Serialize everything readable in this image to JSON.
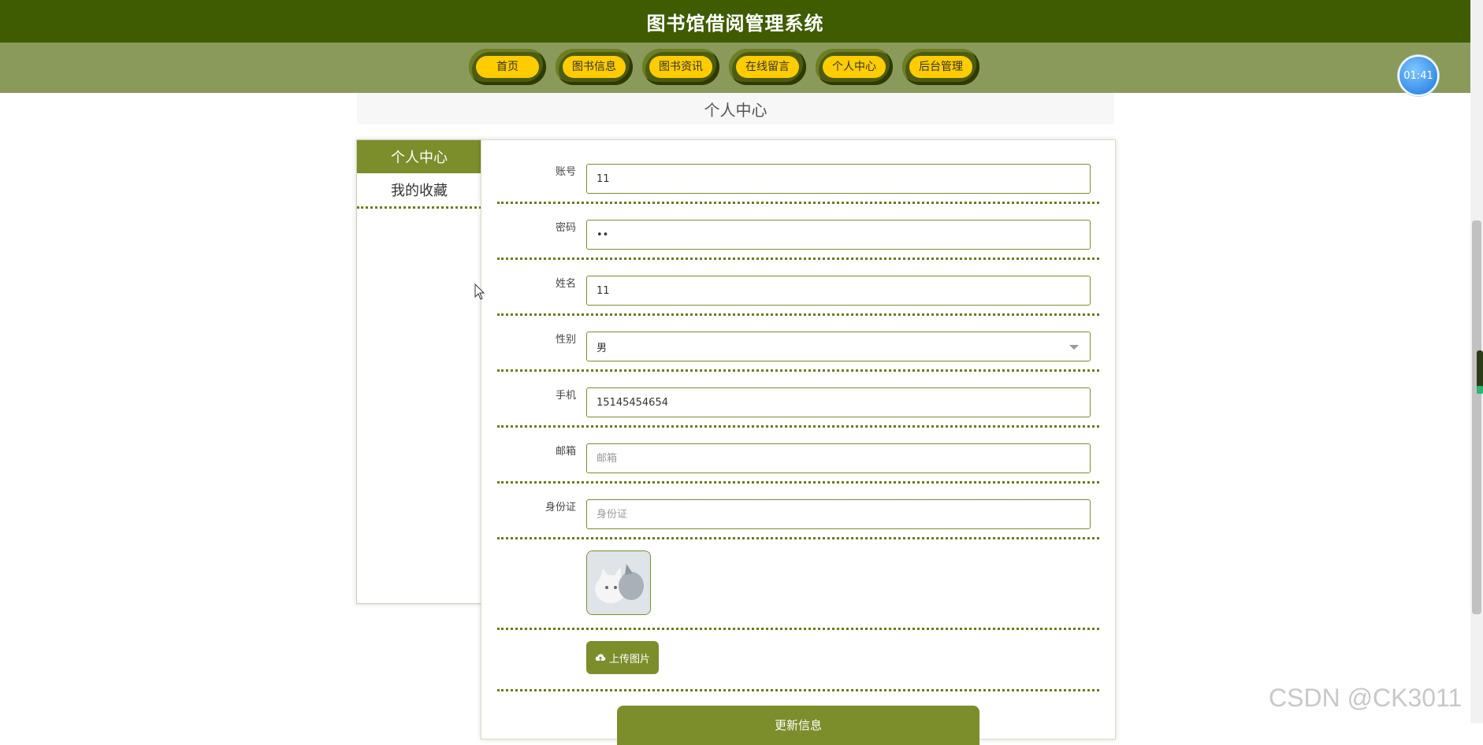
{
  "header": {
    "title": "图书馆借阅管理系统"
  },
  "nav": {
    "items": [
      "首页",
      "图书信息",
      "图书资讯",
      "在线留言",
      "个人中心",
      "后台管理"
    ]
  },
  "clock": {
    "time": "01:41"
  },
  "page": {
    "title": "个人中心"
  },
  "sidebar": {
    "items": [
      {
        "label": "个人中心",
        "active": true
      },
      {
        "label": "我的收藏",
        "active": false
      }
    ]
  },
  "form": {
    "account": {
      "label": "账号",
      "value": "11"
    },
    "password": {
      "label": "密码",
      "value": "••"
    },
    "name": {
      "label": "姓名",
      "value": "11"
    },
    "gender": {
      "label": "性别",
      "value": "男"
    },
    "phone": {
      "label": "手机",
      "value": "15145454654"
    },
    "email": {
      "label": "邮箱",
      "placeholder": "邮箱"
    },
    "idcard": {
      "label": "身份证",
      "placeholder": "身份证"
    },
    "upload_label": "上传图片",
    "submit_label": "更新信息"
  },
  "watermark": "CSDN @CK3011",
  "colors": {
    "header": "#3f5c00",
    "nav": "#8a9a5b",
    "accent": "#7c8d2c",
    "pill": "#ffcc00"
  }
}
